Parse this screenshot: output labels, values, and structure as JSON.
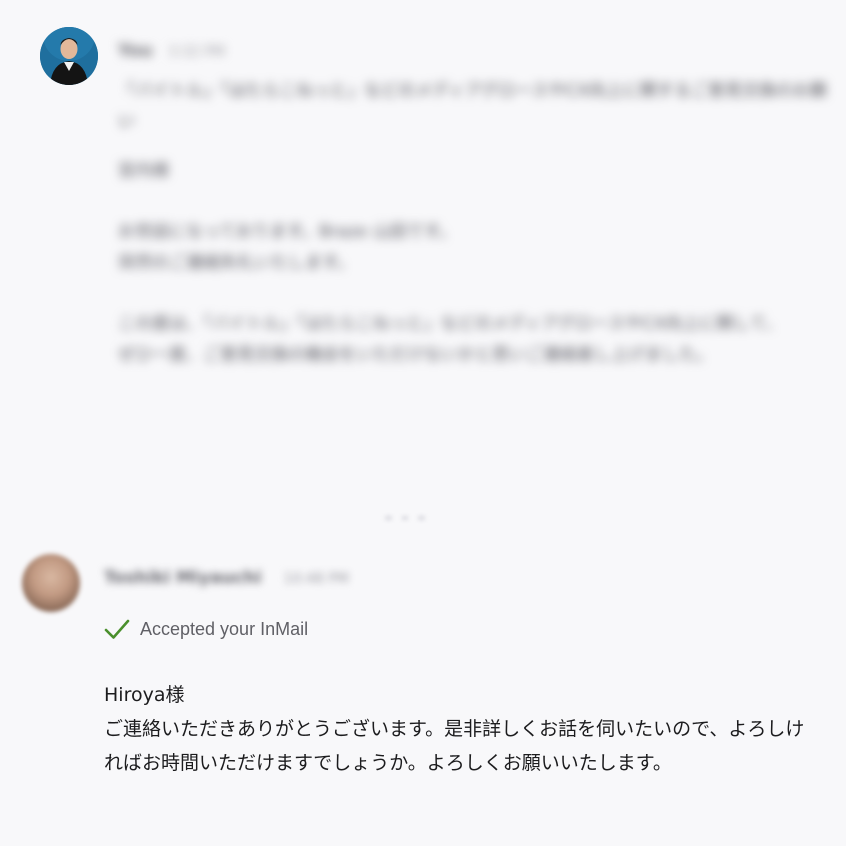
{
  "message_1": {
    "sender": "You",
    "time": "3:32 PM",
    "subject": "「バイトル」「はたらこねっと」などのメディアグロースやCX向上に関するご意見交換のお願い",
    "greeting": "宮内様",
    "paragraph_1": "お世話になっております。Braze 山田です。\n突然のご連絡失礼いたします。",
    "paragraph_2": "この度は、「バイトル」「はたらこねっと」などのメディアグロースやCX向上に関して、\nぜひ一度、ご意見交換の機会をいただけないかと思いご連絡差し上げました。"
  },
  "message_2": {
    "sender": "Toshiki Miyauchi",
    "time": "10:48 PM",
    "accepted_label": "Accepted your InMail",
    "body_line_1": "Hiroya様",
    "body_line_2": "ご連絡いただきありがとうございます。是非詳しくお話を伺いたいので、よろしければお時間いただけますでしょうか。よろしくお願いいたします。"
  },
  "colors": {
    "check": "#4a8f2c",
    "background": "#f8f8fa"
  },
  "icons": {
    "accepted": "check-icon"
  }
}
